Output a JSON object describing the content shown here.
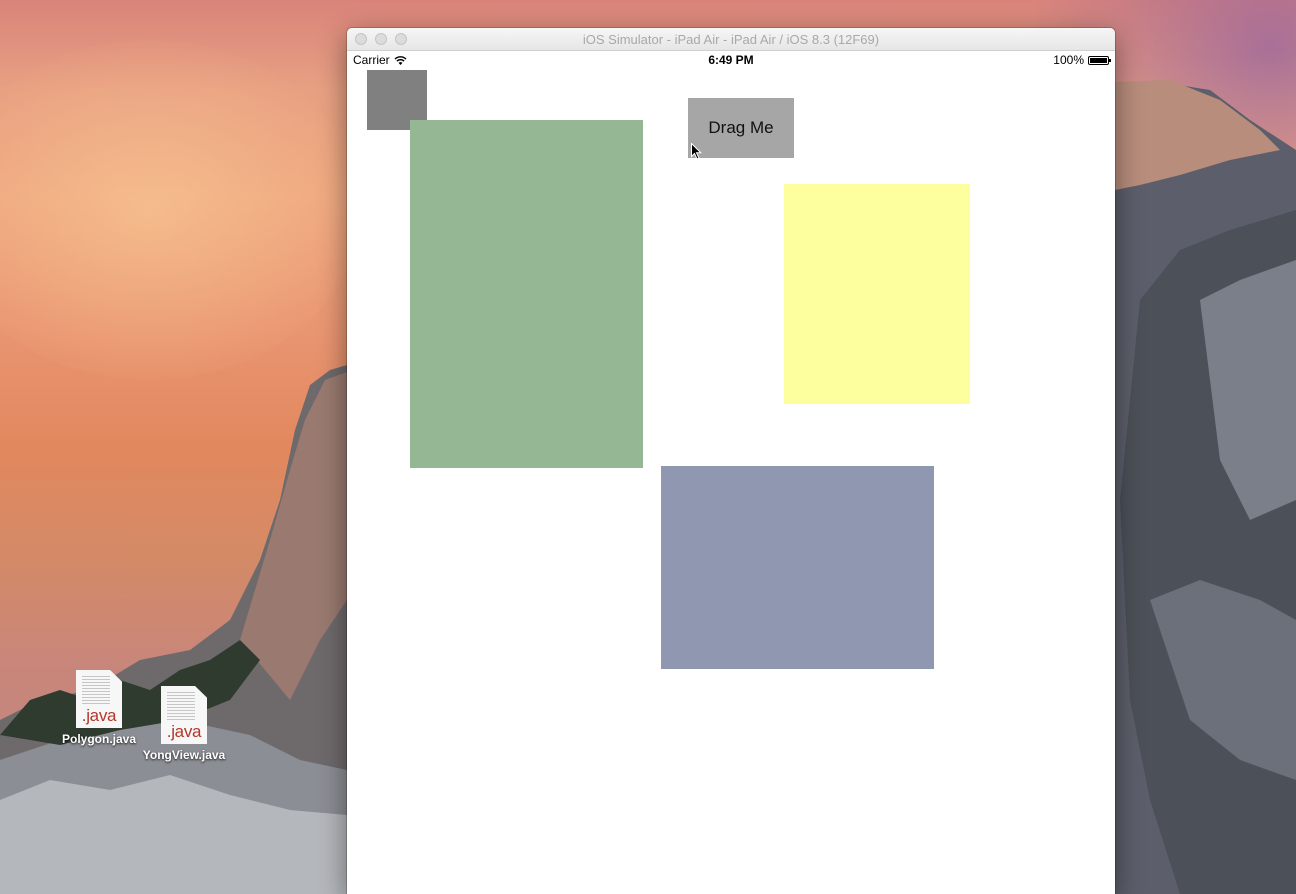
{
  "desktop": {
    "icons": [
      {
        "name": "Polygon.java",
        "ext": ".java"
      },
      {
        "name": "YongView.java",
        "ext": ".java"
      }
    ]
  },
  "window": {
    "title": "iOS Simulator - iPad Air - iPad Air / iOS 8.3 (12F69)"
  },
  "statusbar": {
    "carrier": "Carrier",
    "time": "6:49 PM",
    "battery_percent": "100%"
  },
  "app": {
    "drag_button_label": "Drag Me",
    "colors": {
      "small_square": "#808080",
      "green_rect": "#96b793",
      "yellow_rect": "#fdff9e",
      "blue_rect": "#9097b1",
      "drag_button": "#a6a6a6"
    }
  }
}
